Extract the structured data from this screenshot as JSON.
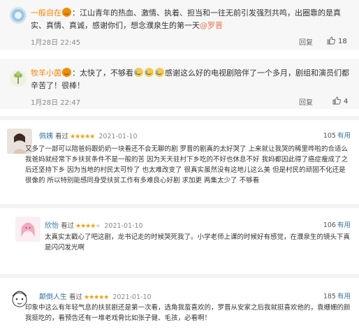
{
  "weibo": [
    {
      "user": "一般自在",
      "text": "江山青年的热血、激情、执着、担当和一往无前引发强烈共鸣，出圈靠的是真实、真情、真诚，感谢你们，想念濮泉生的第一天",
      "mention": "@罗晋",
      "time": "1月28日 22:45",
      "reply": "回复",
      "likes": "18"
    },
    {
      "user": "牧羊小茵",
      "text_before": "太快了，不够看",
      "text_after": "感谢这么好的电视剧陪伴了一个多月，剧组和演员们都辛苦了！很棒！",
      "time": "1月28日 22:47",
      "reply": "回复",
      "likes": "4"
    }
  ],
  "douban": [
    {
      "user": "佩姨",
      "seen": "看过",
      "rating": 5,
      "date": "2021-01-10",
      "votes": "105",
      "useful": "有用",
      "text": "又多了一部可以陪爸妈跟奶奶一块看还不会无聊的剧 罗晋的剧真的太好哭了 上来就让我哭的稀里哗啦的合适么 我爸妈就经常下乡扶贫条件不是一般的苦 因为天天驻村下乡吃的不好也休息不好 我妈都因此得了癌症瘦成了之后还坚持下乡 因为当地的村民太可怜了 也太难改变了 很真实虽然没有这地儿这么美 但是村民的顽固不化还是很像的 所以特别能感同身受扶贫工作有多难良心好剧 求加更 两集太少了 不够看"
    },
    {
      "user": "欣怡",
      "seen": "看过",
      "rating": 4,
      "date": "2021-01-10",
      "votes": "106",
      "useful": "有用",
      "text": "太真实太戳心了吧这剧，龙书记走的时候哭死我了。小学老师上课的时候好有感觉，在濮泉生的镜头下真是闪闪发光啊"
    },
    {
      "user": "颠倒人生",
      "seen": "看过",
      "rating": 5,
      "date": "2021-01-10",
      "votes": "185",
      "useful": "有用",
      "text": "印象中这么有年轻气息的扶贫剧还是第一次看，选角我蛮喜欢的，罗晋从安家之后我就挺喜欢他的，袁姗姗的颜我挺吃的，看预告还有一堆老戏骨比如张子健、毛孩，必看啊！"
    }
  ],
  "colors": {
    "weibo_name": "#ff8200",
    "douban_link": "#3377aa",
    "star": "#f99b01"
  },
  "icons": [
    "like-icon",
    "laugh-emoji",
    "devil-emoji",
    "cry-emoji"
  ]
}
